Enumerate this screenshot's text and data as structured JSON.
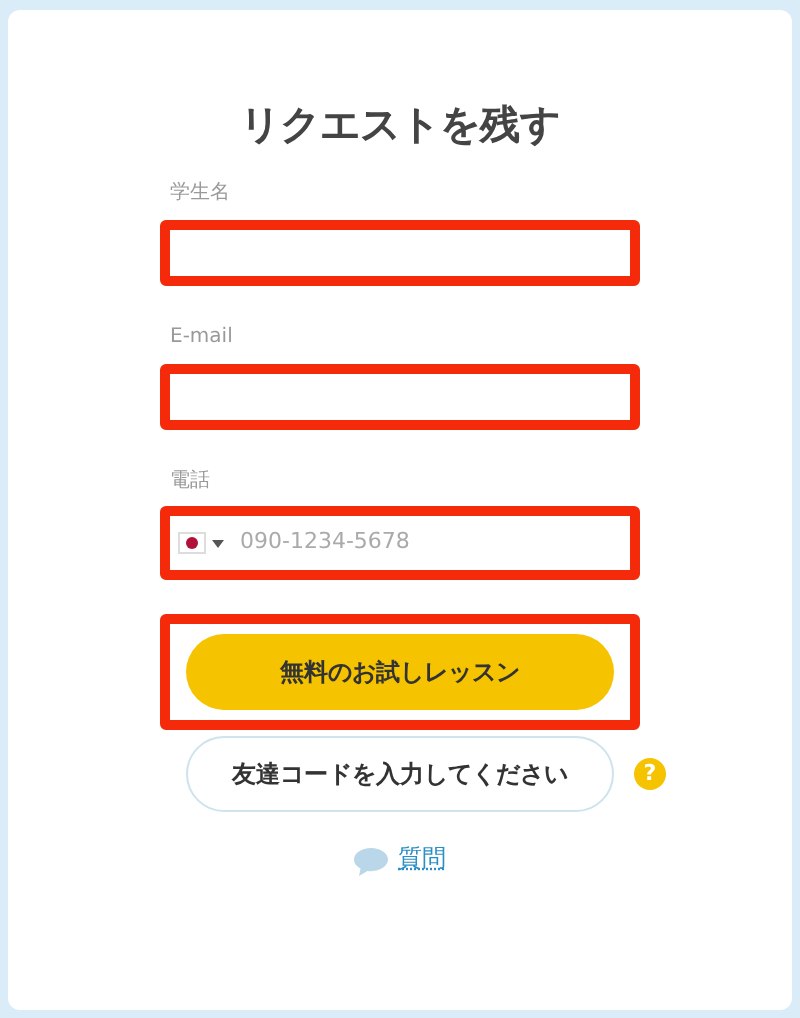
{
  "title": "リクエストを残す",
  "fields": [
    {
      "label": "学生名",
      "kind": "text"
    },
    {
      "label": "E-mail",
      "kind": "text"
    },
    {
      "label": "電話",
      "kind": "phone",
      "placeholder": "090-1234-5678"
    }
  ],
  "trial_button": "無料のお試しレッスン",
  "friend_code_button": "友達コードを入力してください",
  "help_icon": "?",
  "question_link": "質問"
}
